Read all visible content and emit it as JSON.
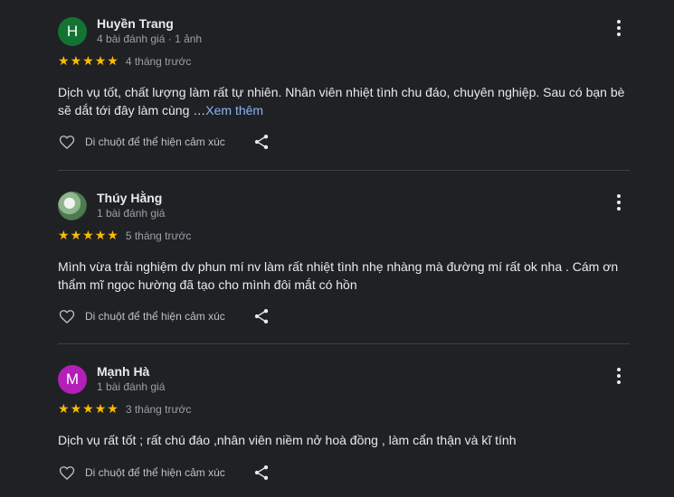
{
  "reviews": [
    {
      "avatar_letter": "H",
      "avatar_color": "#137333",
      "author": "Huyền Trang",
      "meta": "4 bài đánh giá · 1 ảnh",
      "rating": 5,
      "date": "4 tháng trước",
      "text": "Dịch vụ tốt, chất lượng làm rất tự nhiên. Nhân viên nhiệt tình chu đáo, chuyên nghiệp. Sau có bạn bè sẽ dắt tới đây làm cùng …",
      "see_more": "Xem thêm",
      "like_label": "Di chuột để thể hiện cảm xúc",
      "more_icon": "more-vert-icon",
      "like_icon": "heart-outline-icon",
      "share_icon": "share-icon"
    },
    {
      "avatar_letter": "",
      "avatar_color": "#5f7d5a",
      "author": "Thúy Hằng",
      "meta": "1 bài đánh giá",
      "rating": 5,
      "date": "5 tháng trước",
      "text": "Mình vừa trải nghiệm dv phun mí nv làm rất nhiệt tình nhẹ nhàng mà đường mí rất ok nha . Cám ơn thẩm mĩ ngọc hường đã tạo cho mình đôi mắt có hồn",
      "like_label": "Di chuột để thể hiện cảm xúc",
      "more_icon": "more-vert-icon",
      "like_icon": "heart-outline-icon",
      "share_icon": "share-icon"
    },
    {
      "avatar_letter": "M",
      "avatar_color": "#b31fb7",
      "author": "Mạnh Hà",
      "meta": "1 bài đánh giá",
      "rating": 5,
      "date": "3 tháng trước",
      "text": "Dịch vụ rất tốt ; rất chú đáo ,nhân viên niềm nở hoà đồng , làm cẩn thận và kĩ tính",
      "like_label": "Di chuột để thể hiện cảm xúc",
      "more_icon": "more-vert-icon",
      "like_icon": "heart-outline-icon",
      "share_icon": "share-icon"
    }
  ],
  "colors": {
    "background": "#202124",
    "star": "#fbbc04",
    "link": "#8ab4f8",
    "divider": "#3c4043"
  }
}
